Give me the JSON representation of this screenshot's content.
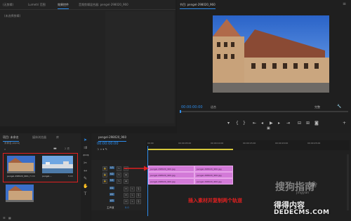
{
  "top_panel": {
    "tabs": [
      "(无剪辑)",
      "Lumetri 范围",
      "效果控件",
      "音频剪辑混合器: pengel-298020_960"
    ],
    "active_tab_index": 2,
    "empty_message": "(未选择剪辑)"
  },
  "program_monitor": {
    "title": "节目: pengel-298020_960",
    "timecode": "00:00:00:00",
    "fit_label": "适合",
    "full_label": "完整",
    "right_timecode": "00:00:05:00"
  },
  "project_panel": {
    "tabs": [
      "项目: 未命名",
      "媒体浏览器",
      "库"
    ],
    "path_label": "未命名.prproj",
    "item_count": "2 项",
    "items": [
      {
        "name": "pengel-298020_960.jpg",
        "duration": "5:00"
      },
      {
        "name": "pengel-...",
        "duration": "5:00"
      }
    ]
  },
  "timeline": {
    "tab_title": "pengel-298020_960",
    "timecode": "00:00:00:00",
    "ruler_labels": [
      "00:00",
      "00:00:05:00",
      "00:00:10:00",
      "00:00:15:00",
      "00:00:20:00",
      "00:00:25:00"
    ],
    "video_tracks": [
      "V3",
      "V2",
      "V1"
    ],
    "audio_tracks": [
      "A1",
      "A2",
      "A3"
    ],
    "master_label": "主声道",
    "master_value": "0.0",
    "clips": [
      {
        "row": "V3",
        "label": "pengel-298020_960.jpg",
        "segment": "left"
      },
      {
        "row": "V3",
        "label": "pengel-298020_960.jpg",
        "segment": "right"
      },
      {
        "row": "V2",
        "label": "pengel-298020_960.jpg",
        "segment": "left"
      },
      {
        "row": "V2",
        "label": "pengel-298020_960.jpg",
        "segment": "right"
      },
      {
        "row": "V1",
        "label": "pengel-298020_960.jpg",
        "segment": "left"
      },
      {
        "row": "V1",
        "label": "pengel-298020_960.jpg",
        "segment": "right"
      }
    ]
  },
  "annotation": {
    "text": "插入素材并复制两个轨道",
    "color": "#e02020"
  },
  "watermark": {
    "line1": "搜狗指南",
    "line2": "jingyan",
    "site_cn": "得得内容",
    "site_url": "DEDECMS.COM"
  },
  "colors": {
    "accent": "#2d8ceb",
    "clip": "#d37ad8",
    "highlight_box": "#e02020"
  }
}
